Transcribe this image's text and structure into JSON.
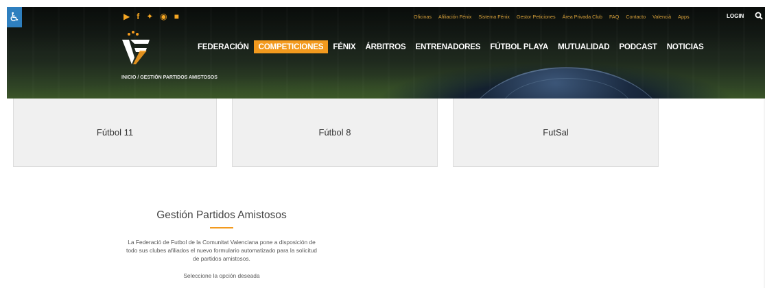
{
  "header": {
    "accessibility_icon": "wheelchair-icon",
    "social_icons": [
      "youtube-icon",
      "facebook-icon",
      "twitter-icon",
      "instagram-icon",
      "lock-icon"
    ],
    "top_links": [
      "Oficinas",
      "Afiliación Fénix",
      "Sistema Fénix",
      "Gestor Peticiones",
      "Área Privada Club",
      "FAQ",
      "Contacto",
      "Valencià",
      "Apps"
    ],
    "login_label": "LOGIN",
    "search_icon": "search-icon",
    "logo_text": "FF"
  },
  "nav": {
    "items": [
      "FEDERACIÓN",
      "COMPETICIONES",
      "FÉNIX",
      "ÁRBITROS",
      "ENTRENADORES",
      "FÚTBOL PLAYA",
      "MUTUALIDAD",
      "PODCAST",
      "NOTICIAS"
    ],
    "active_index": 1
  },
  "breadcrumb": {
    "text": "INICIO  /  GESTIÓN PARTIDOS AMISTOSOS"
  },
  "cards": [
    "Fútbol 11",
    "Fútbol 8",
    "FutSal"
  ],
  "content": {
    "title": "Gestión Partidos Amistosos",
    "paragraph_line1": "La Federació de Futbol de la Comunitat Valenciana pone a disposición de",
    "paragraph_line2": "todo sus clubes afiliados el nuevo formulario automatizado para la solicitud",
    "paragraph_line3": "de partidos amistosos.",
    "select_text": "Seleccione la opción deseada"
  },
  "colors": {
    "accent": "#f39a1e",
    "top_link": "#d9a13b",
    "accessibility": "#2e7fbf",
    "card_bg": "#f0f0f0"
  }
}
